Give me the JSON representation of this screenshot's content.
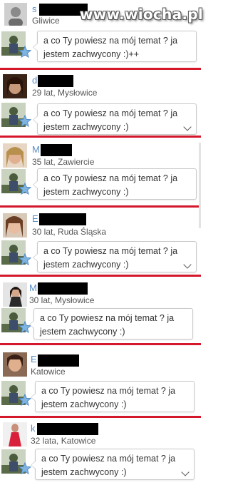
{
  "watermark": "www.wiocha.pl",
  "message": "a co Ty powiesz na mój temat ? ja jestem zachwycony :)",
  "entries": [
    {
      "initial": "s",
      "subtitle": "Gliwice",
      "message": "a co Ty powiesz na mój temat ? ja jestem zachwycony :)++"
    },
    {
      "initial": "d",
      "subtitle": "29 lat, Mysłowice",
      "message": "a co Ty powiesz na mój temat ? ja jestem zachwycony :)"
    },
    {
      "initial": "M",
      "subtitle": "35 lat, Zawiercie",
      "message": "a co Ty powiesz na mój temat ? ja jestem zachwycony :)"
    },
    {
      "initial": "E",
      "subtitle": "30 lat, Ruda Śląska",
      "message": "a co Ty powiesz na mój temat ? ja jestem zachwycony :)"
    },
    {
      "initial": "M",
      "subtitle": "30 lat, Mysłowice",
      "message": "a co Ty powiesz na mój temat ? ja jestem zachwycony :)"
    },
    {
      "initial": "E",
      "subtitle": "Katowice",
      "message": "a co Ty powiesz na mój temat ? ja jestem zachwycony :)"
    },
    {
      "initial": "k",
      "subtitle": "32 lata, Katowice",
      "message": "a co Ty powiesz na mój temat ? ja jestem zachwycony :)"
    }
  ],
  "colors": {
    "accent_red": "#d4172b",
    "name_blue": "#5b8ec2",
    "star_blue": "#7fb3e0"
  }
}
